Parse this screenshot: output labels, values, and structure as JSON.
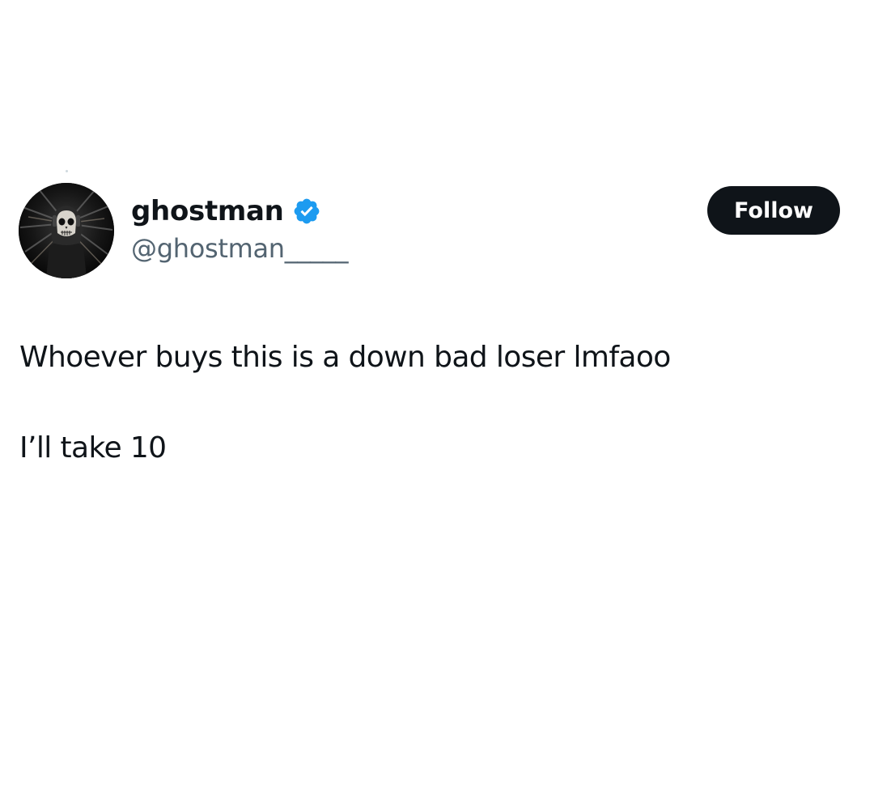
{
  "author": {
    "display_name": "ghostman",
    "handle": "@ghostman_____",
    "verified_icon": "verified-badge-icon",
    "avatar_icon": "ghost-skull-mask-avatar"
  },
  "actions": {
    "follow_label": "Follow"
  },
  "tweet": {
    "lines": [
      "Whoever buys this is a down bad loser lmfaoo",
      "I’ll take 10"
    ]
  },
  "colors": {
    "text_primary": "#0f1419",
    "text_secondary": "#536471",
    "verified_blue": "#1d9bf0",
    "follow_bg": "#0f1419",
    "follow_text": "#ffffff",
    "background": "#ffffff"
  }
}
